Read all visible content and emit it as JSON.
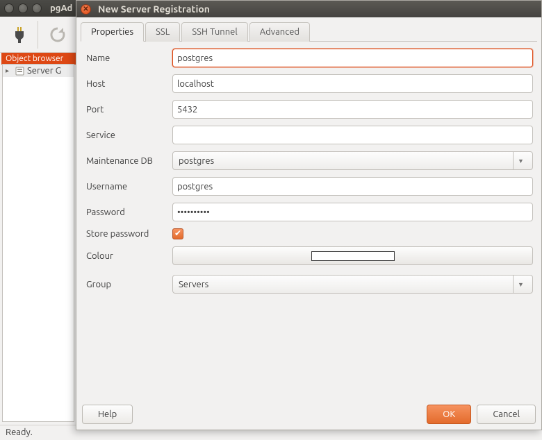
{
  "main_window": {
    "title": "pgAd"
  },
  "object_browser": {
    "header": "Object browser",
    "root_label": "Server G"
  },
  "statusbar": {
    "text": "Ready."
  },
  "dialog": {
    "title": "New Server Registration",
    "tabs": [
      "Properties",
      "SSL",
      "SSH Tunnel",
      "Advanced"
    ],
    "active_tab": 0,
    "labels": {
      "name": "Name",
      "host": "Host",
      "port": "Port",
      "service": "Service",
      "maintenance_db": "Maintenance DB",
      "username": "Username",
      "password": "Password",
      "store_password": "Store password",
      "colour": "Colour",
      "group": "Group"
    },
    "values": {
      "name": "postgres",
      "host": "localhost",
      "port": "5432",
      "service": "",
      "maintenance_db": "postgres",
      "username": "postgres",
      "password": "••••••••••",
      "store_password": true,
      "group": "Servers"
    },
    "buttons": {
      "help": "Help",
      "ok": "OK",
      "cancel": "Cancel"
    }
  }
}
